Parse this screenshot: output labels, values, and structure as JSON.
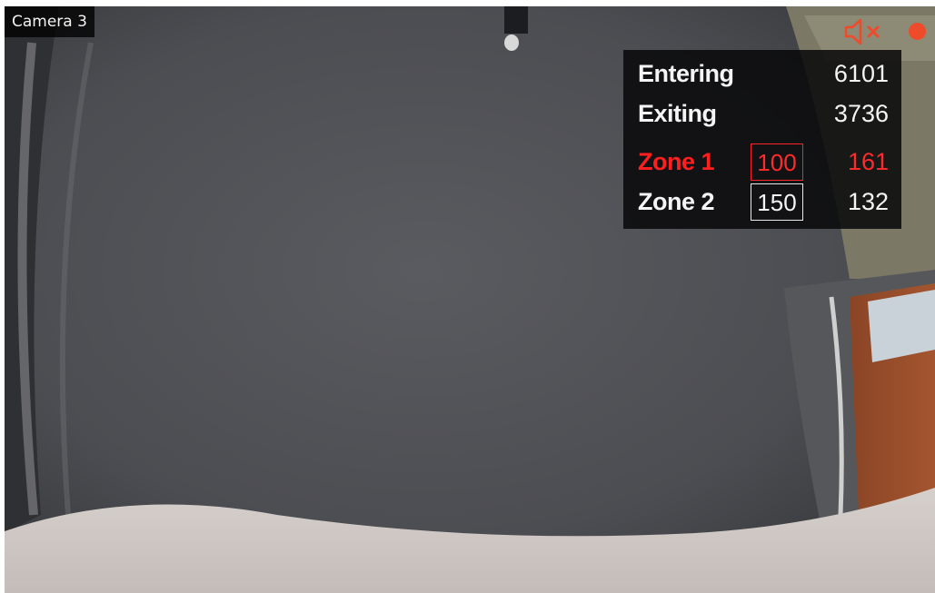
{
  "camera": {
    "label": "Camera 3"
  },
  "icons": {
    "audio": "speaker-muted-icon",
    "recording": "record-dot-icon"
  },
  "counters": {
    "entering": {
      "label": "Entering",
      "value": "6101"
    },
    "exiting": {
      "label": "Exiting",
      "value": "3736"
    },
    "zones": [
      {
        "label": "Zone 1",
        "limit": "100",
        "count": "161",
        "alert": true
      },
      {
        "label": "Zone 2",
        "limit": "150",
        "count": "132",
        "alert": false
      }
    ]
  },
  "colors": {
    "alert": "#ff1f1f",
    "normal_text": "#f4f4f4",
    "indicator": "#ee4b2b",
    "panel_bg": "#08080a"
  }
}
